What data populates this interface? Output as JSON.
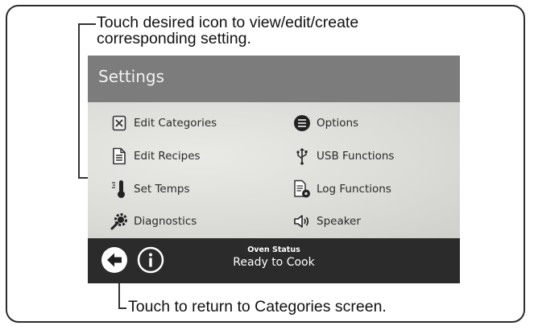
{
  "callouts": {
    "top_line1": "Touch desired icon to view/edit/create",
    "top_line2": "corresponding setting.",
    "bottom": "Touch to return to Categories screen."
  },
  "screen": {
    "title": "Settings",
    "items_left": [
      {
        "label": "Edit Categories",
        "icon": "edit-categories-icon"
      },
      {
        "label": "Edit Recipes",
        "icon": "document-icon"
      },
      {
        "label": "Set Temps",
        "icon": "thermometer-icon"
      },
      {
        "label": "Diagnostics",
        "icon": "gear-wrench-icon"
      }
    ],
    "items_right": [
      {
        "label": "Options",
        "icon": "list-circle-icon"
      },
      {
        "label": "USB Functions",
        "icon": "usb-icon"
      },
      {
        "label": "Log Functions",
        "icon": "log-document-icon"
      },
      {
        "label": "Speaker",
        "icon": "speaker-icon"
      }
    ],
    "status": {
      "caption": "Oven Status",
      "value": "Ready to Cook"
    },
    "buttons": {
      "back": "back-arrow-icon",
      "info": "info-icon"
    }
  },
  "colors": {
    "titlebar": "#7c7c7c",
    "statusbar": "#2b2b2b",
    "panel": "#dcdcd8"
  }
}
